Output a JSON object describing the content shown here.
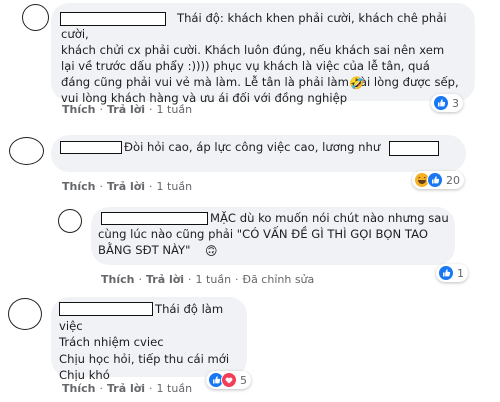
{
  "colors": {
    "bubble": "#f0f2f5",
    "like": "#1877f2",
    "haha": "#f7b125",
    "love": "#f33e58",
    "muted": "#65676b"
  },
  "comments": [
    {
      "text": "Thái độ: khách khen phải cười, khách chê phải cười,\nkhách chửi cx phải cười. Khách luôn đúng, nếu khách sai nên xem\nlại về trước dấu phẩy :)))) phục vụ khách là việc của lễ tân, quá\nđáng cũng phải vui vẻ mà làm. Lễ tân là phải làm hài lòng được sếp,\nvui lòng khách hàng và ưu ái đối với đồng nghiệp",
      "emoji": "🤣",
      "like_label": "Thích",
      "reply_label": "Trả lời",
      "time": "1 tuần",
      "reactions": [
        "like-icon"
      ],
      "reaction_count": "3"
    },
    {
      "text": "Đòi hỏi cao, áp lực công việc cao, lương như",
      "like_label": "Thích",
      "reply_label": "Trả lời",
      "time": "1 tuần",
      "reactions": [
        "haha-icon",
        "like-icon"
      ],
      "reaction_count": "20"
    },
    {
      "text": "MẶC dù ko muốn nói chút nào nhưng sau\ncùng lúc nào cũng phải \"CÓ VẤN ĐỀ GÌ THÌ GỌI BỌN TAO\nBẰNG SĐT NÀY\"",
      "emoji": "🙃",
      "like_label": "Thích",
      "reply_label": "Trả lời",
      "time": "1 tuần",
      "edited": "Đã chỉnh sửa",
      "reactions": [
        "like-icon"
      ],
      "reaction_count": "1"
    },
    {
      "text": "Thái độ làm việc\nTrách nhiệm cviec\nChịu học hỏi, tiếp thu cái mới\nChịu khó",
      "like_label": "Thích",
      "reply_label": "Trả lời",
      "time": "1 tuần",
      "reactions": [
        "like-icon",
        "love-icon"
      ],
      "reaction_count": "5"
    }
  ]
}
